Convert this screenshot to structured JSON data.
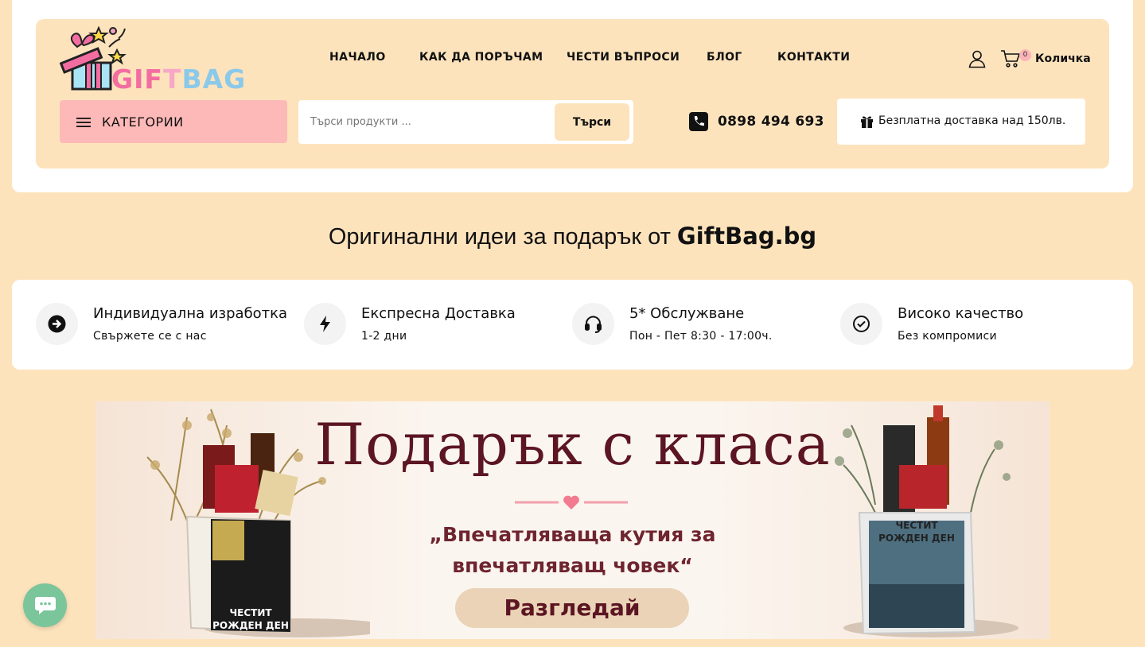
{
  "logo": {
    "text": "GIFTBAG"
  },
  "nav": [
    {
      "label": "НАЧАЛО"
    },
    {
      "label": "КАК ДА ПОРЪЧАМ"
    },
    {
      "label": "ЧЕСТИ ВЪПРОСИ"
    },
    {
      "label": "БЛОГ"
    },
    {
      "label": "КОНТАКТИ"
    }
  ],
  "cart": {
    "count": "0",
    "label": "Количка"
  },
  "categories": {
    "label": "КАТЕГОРИИ"
  },
  "search": {
    "placeholder": "Търси продукти ...",
    "button": "Търси"
  },
  "phone": "0898 494 693",
  "delivery": "Безплатна доставка над 150лв.",
  "tagline": {
    "text": "Оригинални идеи за подарък от ",
    "brand": "GiftBag.bg"
  },
  "features": [
    {
      "title": "Индивидуална изработка",
      "subtitle": "Свържете се с нас",
      "icon": "arrow-right-circle-icon"
    },
    {
      "title": "Експресна Доставка",
      "subtitle": "1-2 дни",
      "icon": "lightning-icon"
    },
    {
      "title": "5* Обслужване",
      "subtitle": "Пон - Пет 8:30 - 17:00ч.",
      "icon": "headset-icon"
    },
    {
      "title": "Високо качество",
      "subtitle": "Без компромиси",
      "icon": "check-circle-icon"
    }
  ],
  "banner": {
    "title": "Подарък с класа",
    "quote_line1": "„Впечатляваща кутия за",
    "quote_line2": "впечатляващ човек“",
    "button": "Разгледай",
    "box_label_line1": "ЧЕСТИТ",
    "box_label_line2": "РОЖДЕН ДЕН"
  },
  "colors": {
    "page_bg": "#fde3bc",
    "category_button": "#fdb9b8",
    "banner_text": "#5c1522",
    "chat_button": "#7bc59b"
  }
}
